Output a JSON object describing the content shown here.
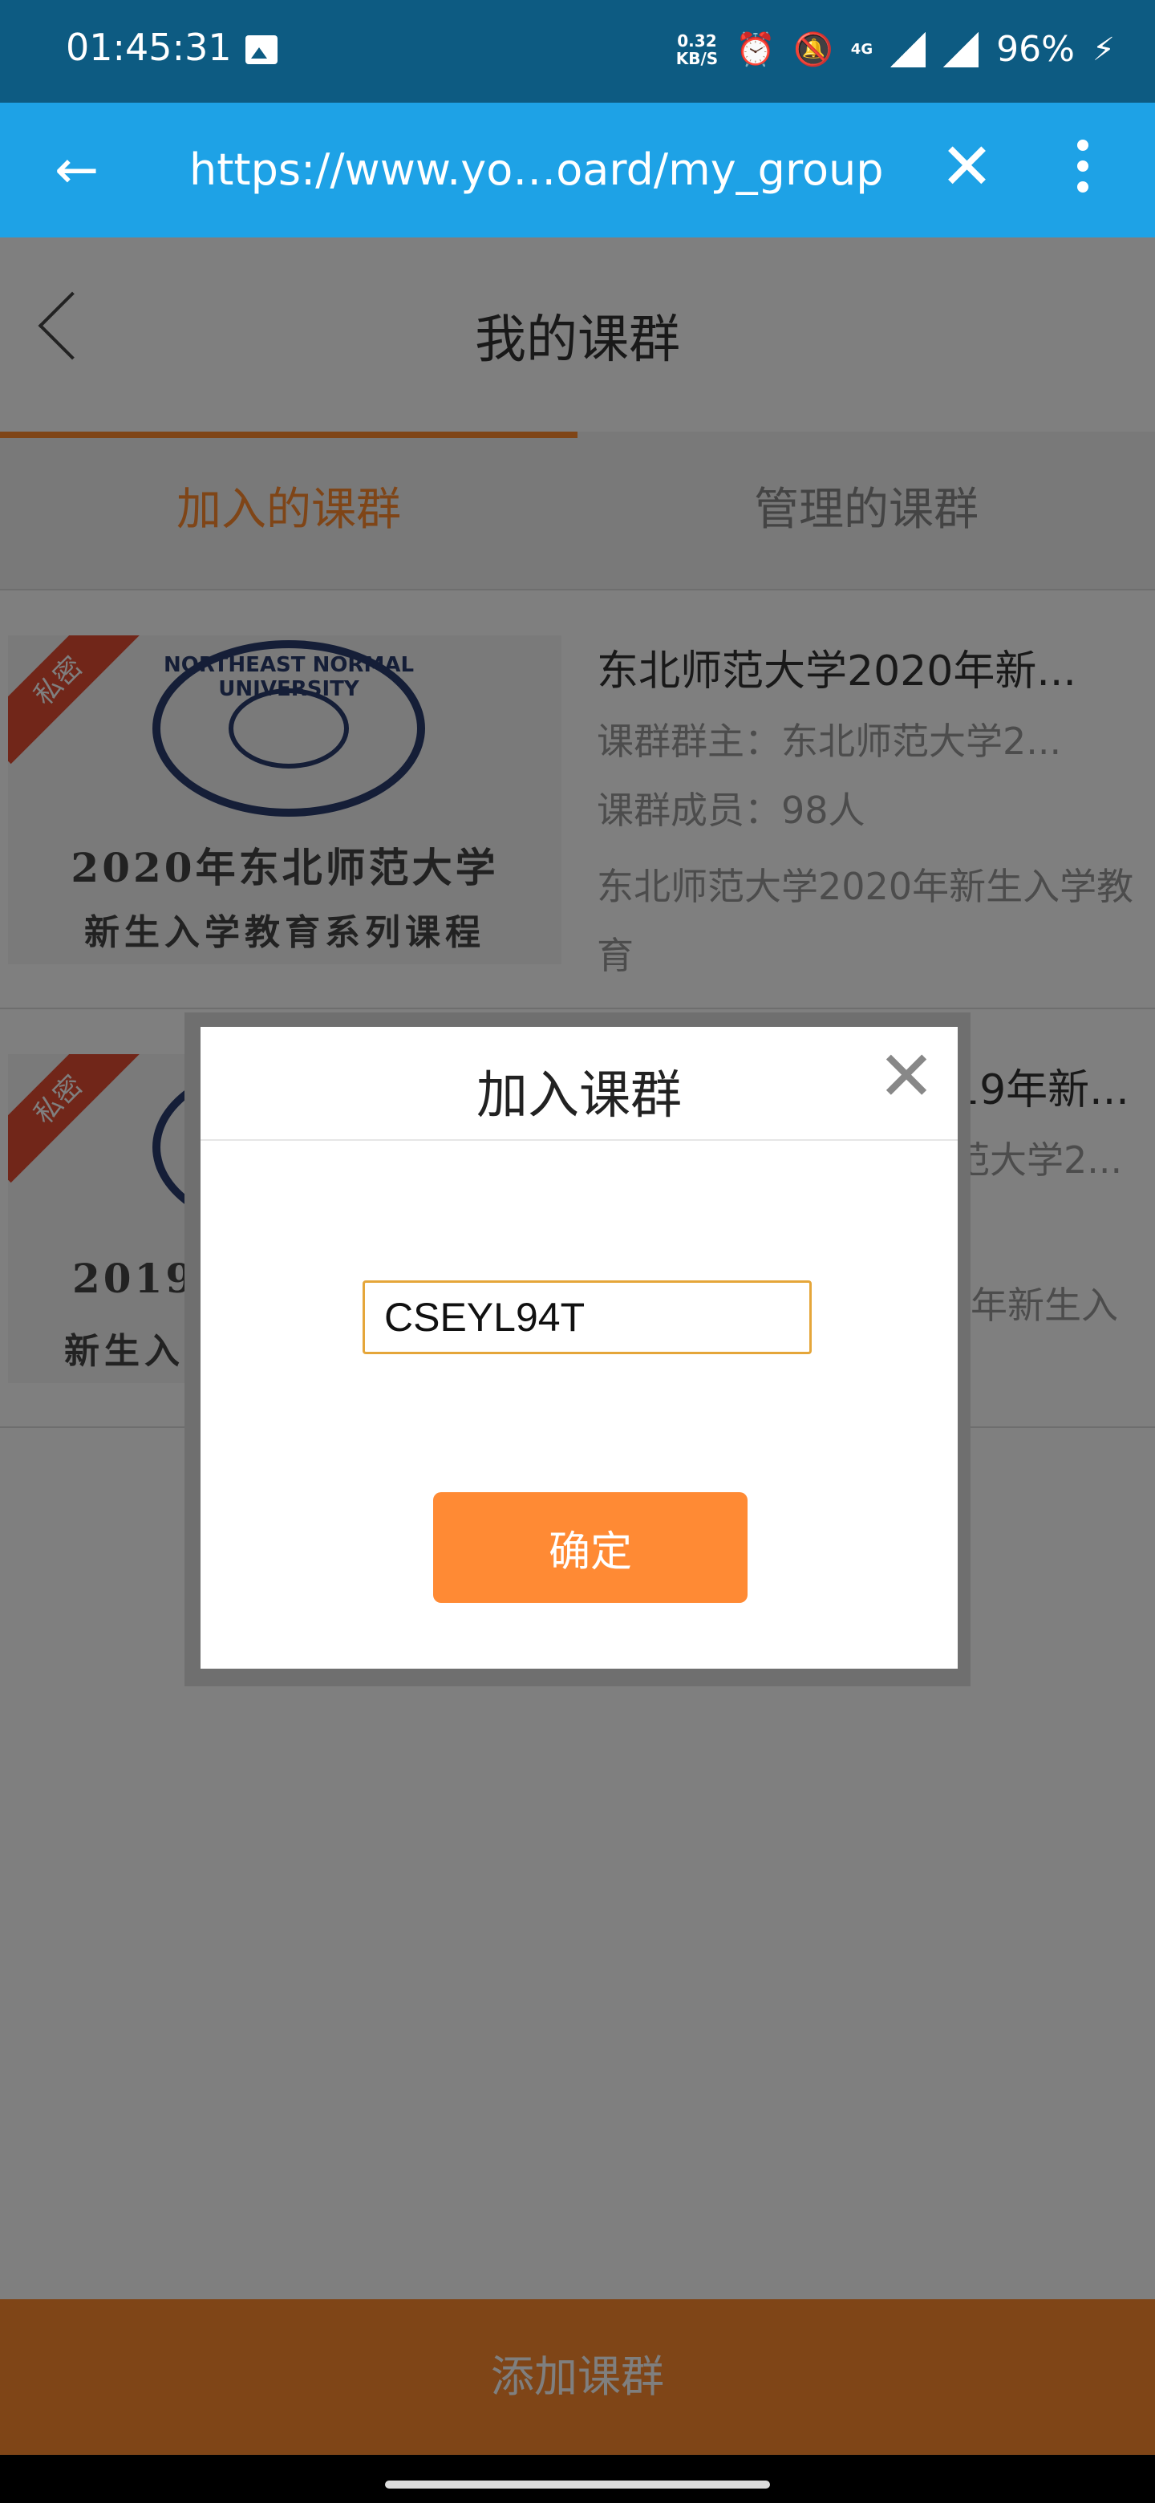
{
  "status_bar": {
    "time": "01:45:31",
    "net_speed_value": "0.32",
    "net_speed_unit": "KB/S",
    "network_label": "4G",
    "battery": "96%"
  },
  "browser": {
    "url": "https://www.yo…oard/my_group"
  },
  "page": {
    "title": "我的课群",
    "tabs": [
      {
        "label": "加入的课群",
        "active": true
      },
      {
        "label": "管理的课群",
        "active": false
      }
    ]
  },
  "courses": [
    {
      "badge": "私密",
      "seal_text": "NORTHEAST NORMAL UNIVERSITY",
      "thumb_line1": "2020年东北师范大学",
      "thumb_line2": "新生入学教育系列课程",
      "title": "东北师范大学2020年新...",
      "owner": "课群群主：东北师范大学2...",
      "members": "课群成员：98人",
      "desc": "东北师范大学2020年新生入学教育"
    },
    {
      "badge": "私密",
      "thumb_line1": "2019",
      "thumb_line2": "新生入",
      "title": "19年新...",
      "owner": "范大学2...",
      "desc": "年新生入"
    }
  ],
  "dialog": {
    "title": "加入课群",
    "close_symbol": "✕",
    "input_value": "CSEYL94T",
    "confirm_label": "确定"
  },
  "bottom": {
    "add_label": "添加课群"
  }
}
